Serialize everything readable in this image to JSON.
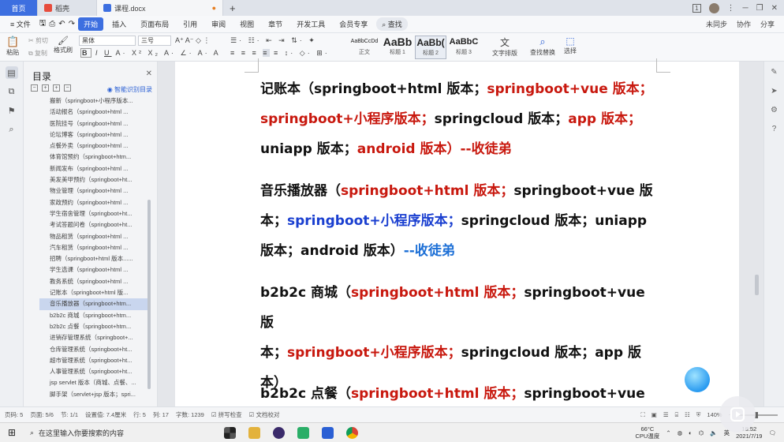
{
  "titlebar": {
    "tabs": [
      {
        "label": "首页",
        "icon": "home-tab"
      },
      {
        "label": "稻壳",
        "icon": "docer-icon"
      },
      {
        "label": "课程.docx",
        "icon": "word-doc-icon"
      }
    ],
    "new_tab": "+",
    "window_count": "1"
  },
  "menubar": {
    "file": "≡ 文件",
    "items": [
      "开始",
      "插入",
      "页面布局",
      "引用",
      "审阅",
      "视图",
      "章节",
      "开发工具",
      "会员专享"
    ],
    "search": "查找",
    "right": [
      "未同步",
      "协作",
      "分享"
    ]
  },
  "ribbon": {
    "paste": "粘贴",
    "cut": "剪切",
    "copy": "复制",
    "format_painter": "格式刷",
    "font_name": "黑体",
    "font_size": "三号",
    "styles": [
      {
        "sample": "AaBbCcDd",
        "label": "正文"
      },
      {
        "sample": "AaBb",
        "label": "标题 1"
      },
      {
        "sample": "AaBb(",
        "label": "标题 2"
      },
      {
        "sample": "AaBbC",
        "label": "标题 3"
      }
    ],
    "text_layout": "文字排版",
    "find_replace": "查找替换",
    "select": "选择"
  },
  "toc": {
    "title": "目录",
    "smart": "智能识别目录",
    "items": [
      "搬新（springboot+小程序版本...",
      "活动报名（springboot+html ...",
      "医院挂号（springboot+html ...",
      "论坛博客（springboot+html ...",
      "点餐外卖（springboot+html ...",
      "体育馆预约（springboot+htm...",
      "新闻发布（springboot+html ...",
      "美发美甲预约（springboot+ht...",
      "物业管理（springboot+html ...",
      "家政预约（springboot+html ...",
      "学生宿舍管理（springboot+ht...",
      "考试答题问卷（springboot+ht...",
      "物品租赁（springboot+html ...",
      "汽车租赁（springboot+html ...",
      "招聘（springboot+html 版本......",
      "学生选课（springboot+html ...",
      "教务系统（springboot+html ...",
      "记账本（springboot+html 版...",
      "音乐播放器（springboot+htm...",
      "b2b2c 商城（springboot+htm...",
      "b2b2c 点餐（springboot+htm...",
      "进销存管理系统（springboot+...",
      "仓库管理系统（springboot+ht...",
      "超市管理系统（springboot+ht...",
      "人事管理系统（springboot+ht...",
      "jsp servlet 版本（商城、点餐、...",
      "脚手架（servlet+jsp 版本；spri..."
    ],
    "selected_index": 18
  },
  "document": {
    "p1": {
      "a": "记账本（springboot+html 版本；",
      "b": "springboot+vue 版本；",
      "c": "springboot+小程序版本；",
      "d": "springcloud 版本；",
      "e": "app 版本；",
      "f": "uniapp 版本；",
      "g": "android 版本）--收徒弟"
    },
    "p2": {
      "a": "音乐播放器（",
      "b": "springboot+html 版本；",
      "c": "springboot+vue 版",
      "d": "本；",
      "e": "springboot+小程序版本；",
      "f": "springcloud 版本；uniapp",
      "g": "版本；android 版本）",
      "h": "--收徒弟"
    },
    "p3": {
      "a": "b2b2c 商城（",
      "b": "springboot+html 版本；",
      "c": "springboot+vue 版",
      "d": "本；",
      "e": "springboot+小程序版本；",
      "f": "springcloud 版本；app 版",
      "g": "本）"
    },
    "p4": {
      "a": "b2b2c 点餐（",
      "b": "springboot+html 版本；",
      "c": "springboot+vue 版"
    }
  },
  "statusbar": {
    "page": "页码: 5",
    "pages": "页面: 5/6",
    "section": "节: 1/1",
    "setting": "设置值: 7.4厘米",
    "row": "行: 5",
    "col": "列: 17",
    "words": "字数: 1239",
    "spell": "拼写检查",
    "proof": "文档校对",
    "zoom": "140%",
    "zoom_level": 0.45
  },
  "taskbar": {
    "search_placeholder": "在这里输入你要搜索的内容",
    "weather_temp": "66°C",
    "weather_label": "CPU温度",
    "time": "18:52",
    "date": "2021/7/19",
    "ime": "英"
  }
}
